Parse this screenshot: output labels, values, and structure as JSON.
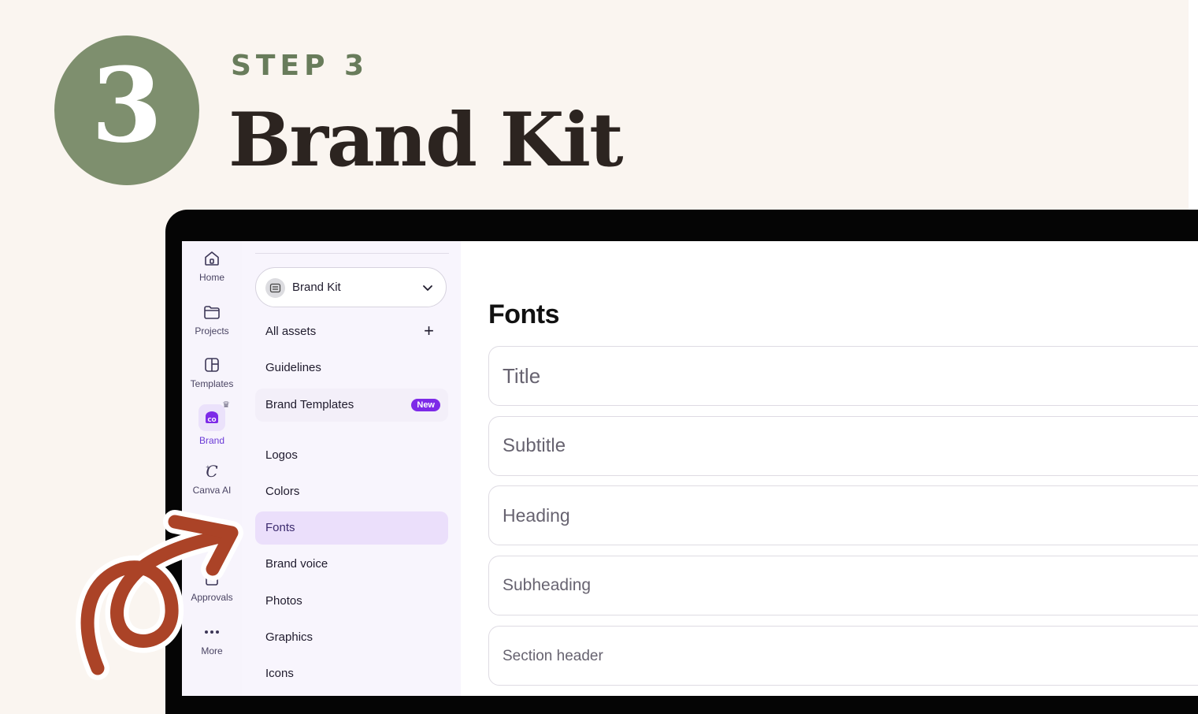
{
  "header": {
    "step_number": "3",
    "step_label": "STEP 3",
    "title": "Brand Kit"
  },
  "nav_rail": {
    "items": [
      {
        "label": "Home",
        "icon": "home-icon"
      },
      {
        "label": "Projects",
        "icon": "folder-icon"
      },
      {
        "label": "Templates",
        "icon": "templates-icon"
      },
      {
        "label": "Brand",
        "icon": "brand-icon",
        "active": true
      },
      {
        "label": "Canva AI",
        "icon": "canva-ai-icon"
      },
      {
        "label": "Approvals",
        "icon": "approvals-icon"
      },
      {
        "label": "More",
        "icon": "more-icon"
      }
    ]
  },
  "panel": {
    "kit_selector": "Brand Kit",
    "menu": {
      "all_assets": "All assets",
      "guidelines": "Guidelines",
      "brand_templates": "Brand Templates",
      "new_badge": "New",
      "logos": "Logos",
      "colors": "Colors",
      "fonts": "Fonts",
      "brand_voice": "Brand voice",
      "photos": "Photos",
      "graphics": "Graphics",
      "icons": "Icons"
    },
    "active_item": "Fonts"
  },
  "main": {
    "title": "Fonts",
    "font_rows": [
      "Title",
      "Subtitle",
      "Heading",
      "Subheading",
      "Section header"
    ]
  },
  "colors": {
    "background": "#faf5f0",
    "step_circle": "#7e8f6e",
    "accent_purple": "#7d2ae8",
    "arrow": "#ab4327"
  }
}
